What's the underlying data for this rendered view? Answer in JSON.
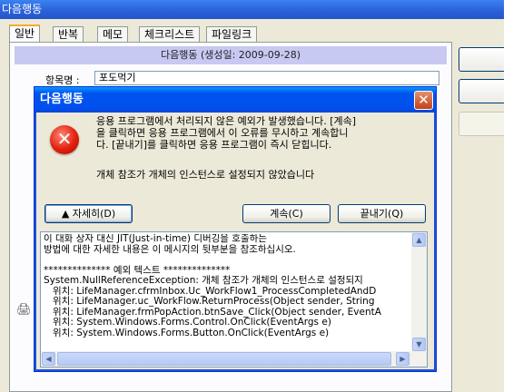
{
  "background_window": {
    "title": "다음행동",
    "tabs": [
      "일반",
      "반복",
      "메모",
      "체크리스트",
      "파일링크"
    ],
    "header": "다음행동 (생성일: 2009-09-28)",
    "item_label": "항목명 :",
    "item_value": "포도먹기"
  },
  "dialog": {
    "title": "다음행동",
    "close_symbol": "✕",
    "message_lines": [
      "응용 프로그램에서 처리되지 않은 예외가 발생했습니다. [계속]",
      "을 클릭하면 응용 프로그램에서 이 오류를 무시하고 계속합니",
      "다. [끝내기]를 클릭하면 응용 프로그램이 즉시 닫힙니다."
    ],
    "message_detail": "개체 참조가 개체의 인스턴스로 설정되지 않았습니다",
    "details_button": "▲ 자세히(D)",
    "continue_button": "계속(C)",
    "quit_button": "끝내기(Q)",
    "details_text": "이 대화 상자 대신 JIT(Just-in-time) 디버깅을 호출하는\n방법에 대한 자세한 내용은 이 메시지의 뒷부분을 참조하십시오.\n\n************** 예외 텍스트 **************\nSystem.NullReferenceException: 개체 참조가 개체의 인스턴스로 설정되지\n   위치: LifeManager.cfrmInbox.Uc_WorkFlow1_ProcessCompletedAndD\n   위치: LifeManager.uc_WorkFlow.ReturnProcess(Object sender, String\n   위치: LifeManager.frmPopAction.btnSave_Click(Object sender, EventA\n   위치: System.Windows.Forms.Control.OnClick(EventArgs e)\n   위치: System.Windows.Forms.Button.OnClick(EventArgs e)"
  },
  "icons": {
    "error": "error-x-icon",
    "printer": "printer-icon"
  },
  "colors": {
    "xp_title_blue": "#0053ee",
    "error_red": "#e2200d",
    "header_strip": "#c7c9f2",
    "active_tab_accent": "#f6ac33"
  }
}
